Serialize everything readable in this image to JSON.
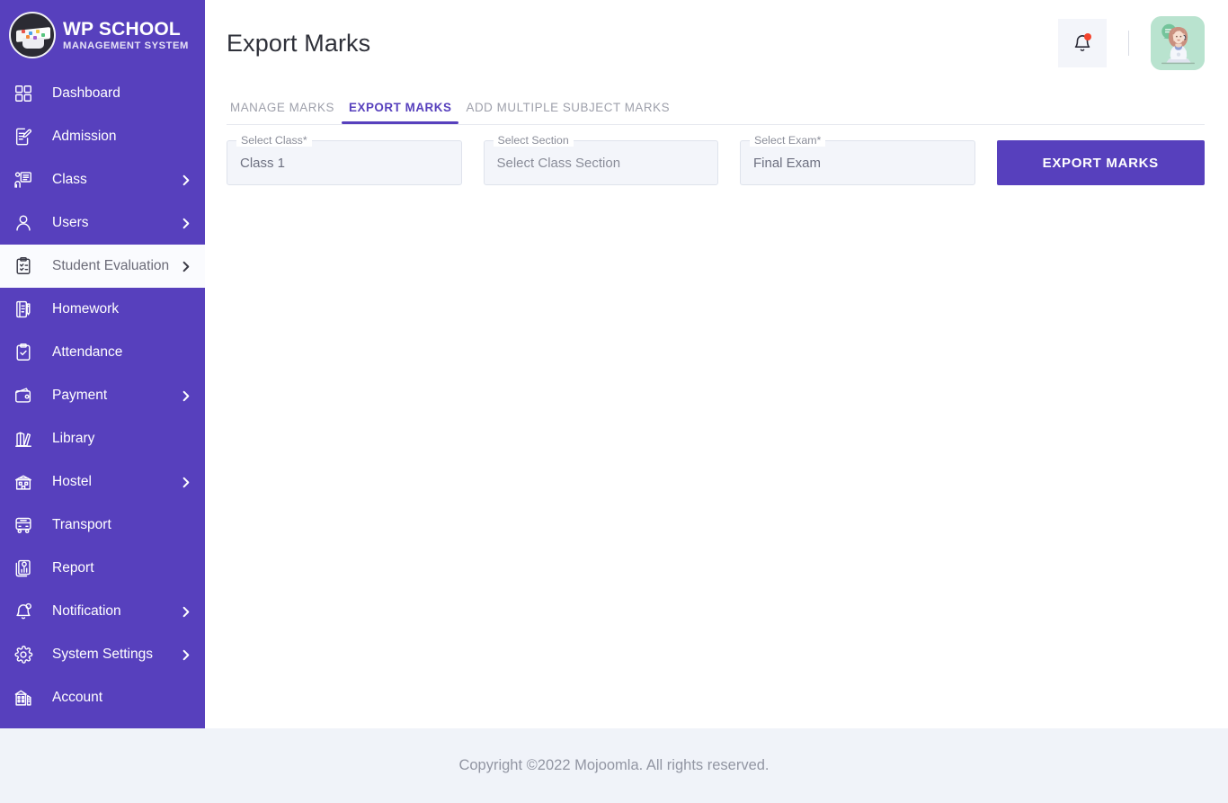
{
  "brand": {
    "logo_icon": "graduation-cap-logo",
    "title": "WP SCHOOL",
    "subtitle": "MANAGEMENT SYSTEM"
  },
  "colors": {
    "sidebar_purple": "#5740bd",
    "accent_purple": "#5740bd",
    "active_item_bg": "#fafbfe",
    "field_bg": "#f3f5fa",
    "footer_bg": "#f0f3f9",
    "badge_red": "#f4442e",
    "avatar_bg": "#b9e3cf"
  },
  "sidebar": {
    "items": [
      {
        "label": "Dashboard",
        "icon": "grid-icon",
        "expandable": false,
        "active": false
      },
      {
        "label": "Admission",
        "icon": "document-pen-icon",
        "expandable": false,
        "active": false
      },
      {
        "label": "Class",
        "icon": "presenter-icon",
        "expandable": true,
        "active": false
      },
      {
        "label": "Users",
        "icon": "user-icon",
        "expandable": true,
        "active": false
      },
      {
        "label": "Student Evaluation",
        "icon": "clipboard-check-icon",
        "expandable": true,
        "active": true
      },
      {
        "label": "Homework",
        "icon": "notebook-pen-icon",
        "expandable": false,
        "active": false
      },
      {
        "label": "Attendance",
        "icon": "clipboard-tick-icon",
        "expandable": false,
        "active": false
      },
      {
        "label": "Payment",
        "icon": "wallet-icon",
        "expandable": true,
        "active": false
      },
      {
        "label": "Library",
        "icon": "books-icon",
        "expandable": false,
        "active": false
      },
      {
        "label": "Hostel",
        "icon": "hostel-building-icon",
        "expandable": true,
        "active": false
      },
      {
        "label": "Transport",
        "icon": "bus-icon",
        "expandable": false,
        "active": false
      },
      {
        "label": "Report",
        "icon": "report-chart-icon",
        "expandable": false,
        "active": false
      },
      {
        "label": "Notification",
        "icon": "bell-icon",
        "expandable": true,
        "active": false
      },
      {
        "label": "System Settings",
        "icon": "gear-icon",
        "expandable": true,
        "active": false
      },
      {
        "label": "Account",
        "icon": "bank-building-icon",
        "expandable": false,
        "active": false
      }
    ]
  },
  "header": {
    "title": "Export Marks",
    "notification_icon": "bell-icon",
    "notification_has_badge": true,
    "avatar_icon": "user-avatar-support-agent"
  },
  "tabs": [
    {
      "label": "MANAGE MARKS",
      "active": false
    },
    {
      "label": "EXPORT MARKS",
      "active": true
    },
    {
      "label": "ADD MULTIPLE SUBJECT MARKS",
      "active": false
    }
  ],
  "form": {
    "fields": [
      {
        "legend": "Select Class*",
        "value": "Class 1",
        "is_placeholder": false,
        "icon": "chevron-down-icon"
      },
      {
        "legend": "Select Section",
        "value": "Select Class Section",
        "is_placeholder": true,
        "icon": "chevron-down-icon"
      },
      {
        "legend": "Select Exam*",
        "value": "Final Exam",
        "is_placeholder": false,
        "icon": "chevron-down-icon"
      }
    ],
    "submit_label": "EXPORT MARKS"
  },
  "footer": {
    "text": "Copyright ©2022 Mojoomla. All rights reserved."
  }
}
